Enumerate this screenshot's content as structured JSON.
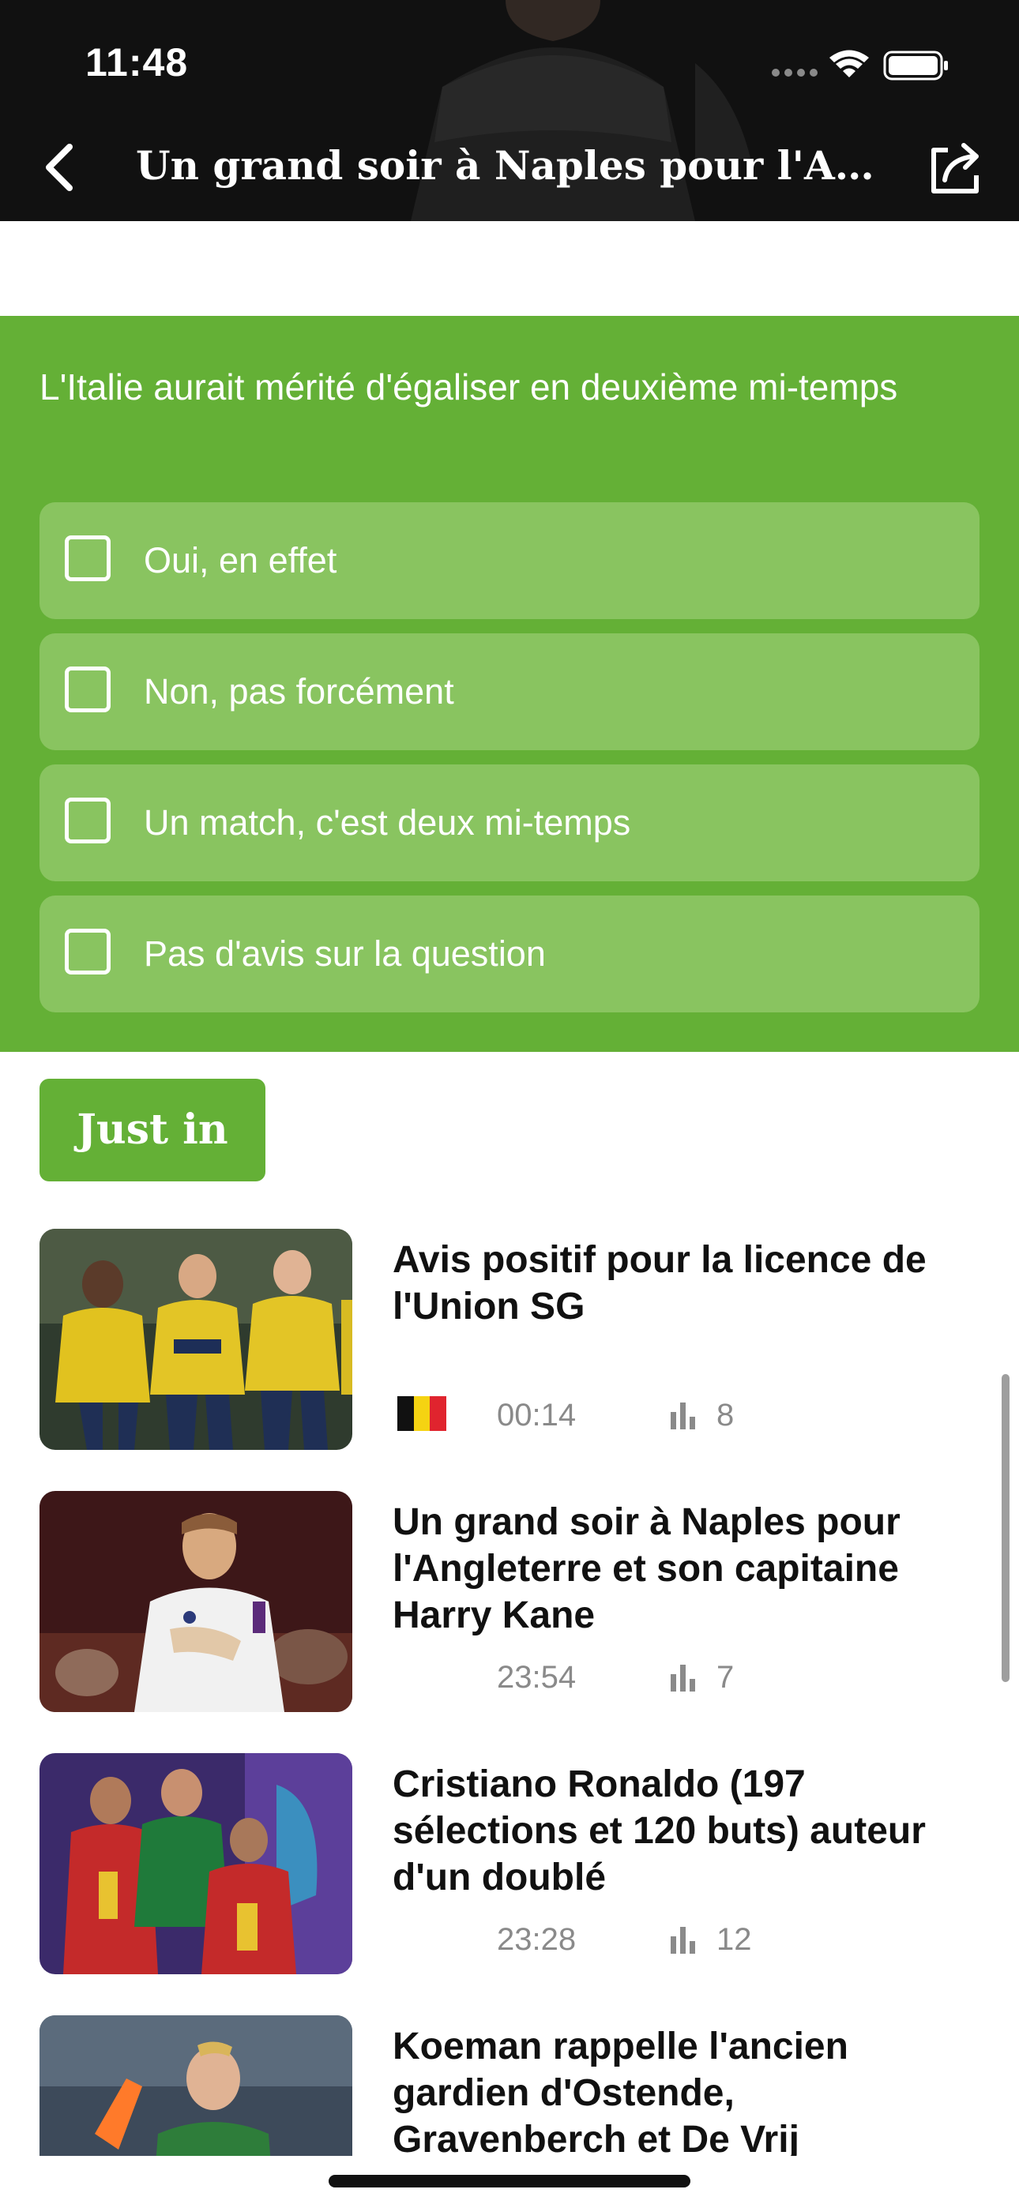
{
  "status_bar": {
    "time": "11:48"
  },
  "nav": {
    "title": "Un grand soir à Naples pour l'Angleterre et son capitaine Harry Kane",
    "back_icon": "chevron-left-icon",
    "share_icon": "share-icon"
  },
  "poll": {
    "question": "L'Italie aurait mérité d'égaliser en deuxième mi-temps",
    "options": [
      "Oui, en effet",
      "Non, pas forcément",
      "Un match, c'est deux mi-temps",
      "Pas d'avis sur la question"
    ],
    "background": "#64b036",
    "option_background": "#89c460"
  },
  "just_in": {
    "label": "Just in"
  },
  "articles": [
    {
      "title": "Avis positif pour la licence de l'Union SG",
      "time": "00:14",
      "count": "8",
      "flag": "belgium-flag"
    },
    {
      "title": "Un grand soir à Naples pour l'Angleterre et son capitaine Harry Kane",
      "time": "23:54",
      "count": "7"
    },
    {
      "title": "Cristiano Ronaldo  (197 sélections et 120 buts) auteur d'un doublé",
      "time": "23:28",
      "count": "12"
    },
    {
      "title": "Koeman rappelle l'ancien gardien d'Ostende, Gravenberch et De Vrij"
    }
  ],
  "colors": {
    "accent": "#64b036",
    "meta_text": "#8a8a8a"
  }
}
